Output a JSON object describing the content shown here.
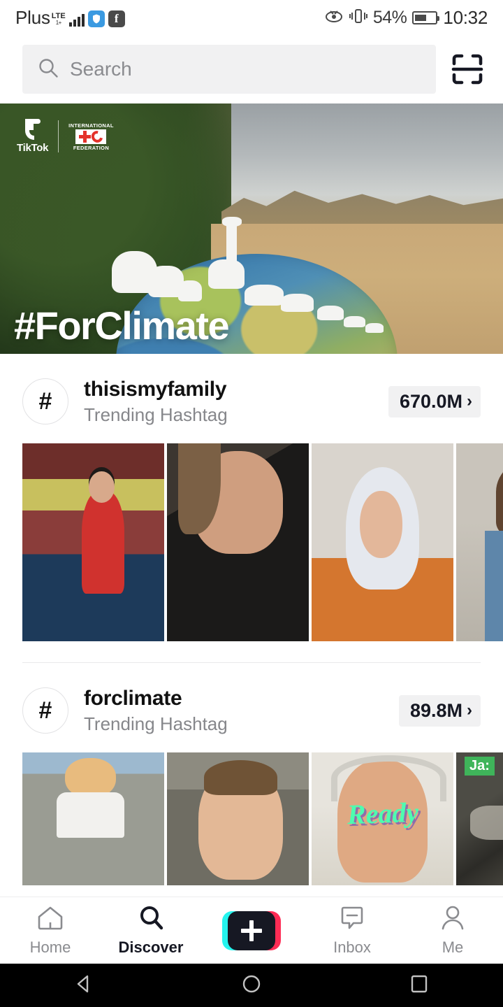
{
  "status_bar": {
    "carrier": "Plus",
    "network": "LTE",
    "network_sub": "1+",
    "icons": [
      "signal-bars-icon",
      "shield-app-icon",
      "facebook-app-icon",
      "eye-icon",
      "vibrate-icon",
      "battery-icon"
    ],
    "battery_percent": "54%",
    "time": "10:32"
  },
  "search": {
    "placeholder": "Search",
    "icon": "search-icon",
    "scan_icon": "qr-scan-icon"
  },
  "banner": {
    "title": "#ForClimate",
    "tiktok_label": "TikTok",
    "partner_top": "INTERNATIONAL",
    "partner_bottom": "FEDERATION",
    "partner_name": "International Federation Red Cross Red Crescent"
  },
  "sections": [
    {
      "hash_symbol": "#",
      "name": "thisismyfamily",
      "subtitle": "Trending Hashtag",
      "count": "670.0M",
      "chevron": "›",
      "thumbs": [
        {
          "art": "a1",
          "caption": "",
          "tag": ""
        },
        {
          "art": "a2",
          "caption": "",
          "tag": ""
        },
        {
          "art": "a3",
          "caption": "",
          "tag": ""
        },
        {
          "art": "a4",
          "caption": "",
          "tag": ""
        }
      ]
    },
    {
      "hash_symbol": "#",
      "name": "forclimate",
      "subtitle": "Trending Hashtag",
      "count": "89.8M",
      "chevron": "›",
      "thumbs": [
        {
          "art": "b1",
          "caption": "",
          "tag": ""
        },
        {
          "art": "b2",
          "caption": "",
          "tag": ""
        },
        {
          "art": "b3",
          "caption": "Ready",
          "tag": ""
        },
        {
          "art": "b4",
          "caption": "",
          "tag": "Ja:"
        }
      ]
    }
  ],
  "tabbar": {
    "items": [
      {
        "label": "Home",
        "icon": "home-icon",
        "active": false
      },
      {
        "label": "Discover",
        "icon": "search-icon",
        "active": true
      },
      {
        "label": "",
        "icon": "create-plus-icon",
        "active": false
      },
      {
        "label": "Inbox",
        "icon": "inbox-icon",
        "active": false
      },
      {
        "label": "Me",
        "icon": "person-icon",
        "active": false
      }
    ]
  },
  "android_nav": {
    "back": "back-triangle-icon",
    "home": "home-circle-icon",
    "recents": "recents-square-icon"
  },
  "colors": {
    "accent_cyan": "#25F4EE",
    "accent_pink": "#FE2C55",
    "text_primary": "#161823",
    "text_secondary": "#86878B",
    "chip_bg": "#F1F1F2"
  }
}
